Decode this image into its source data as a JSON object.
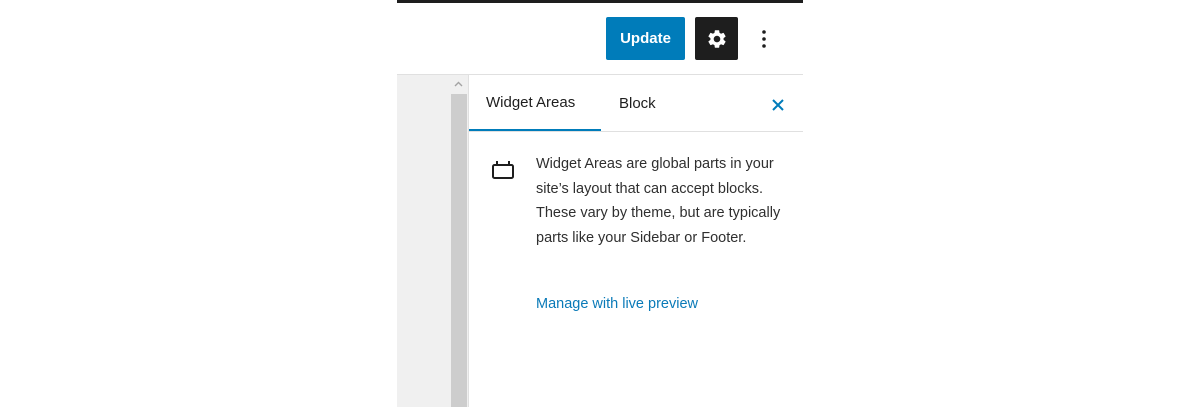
{
  "header": {
    "update_label": "Update",
    "settings_icon": "gear-icon",
    "more_icon": "vertical-ellipsis-icon"
  },
  "sidebar": {
    "tabs": [
      {
        "label": "Widget Areas",
        "active": true
      },
      {
        "label": "Block",
        "active": false
      }
    ],
    "close_icon": "close-icon",
    "panel": {
      "icon": "widget-area-icon",
      "description": "Widget Areas are global parts in your site’s layout that can accept blocks. These vary by theme, but are typically parts like your Sidebar or Footer.",
      "link_label": "Manage with live preview"
    }
  },
  "colors": {
    "accent": "#007cba",
    "dark": "#1e1e1e",
    "link": "#0a7ab8",
    "canvas": "#f0f0f0"
  }
}
